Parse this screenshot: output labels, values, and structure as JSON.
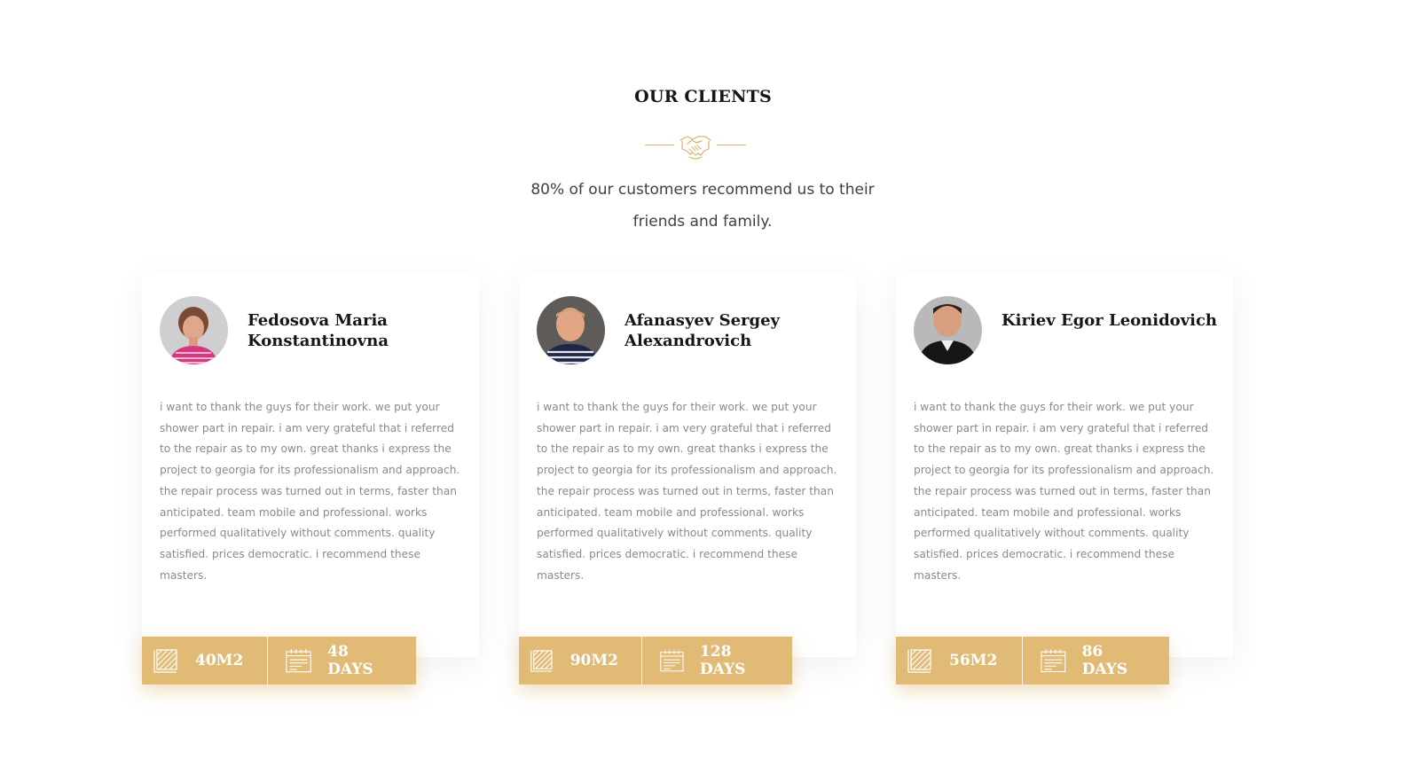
{
  "section": {
    "title": "OUR CLIENTS",
    "divider_icon": "handshake-icon",
    "subtitle": "80% of our customers recommend us to their friends and family."
  },
  "colors": {
    "accent": "#e1bb75",
    "heading": "#161616",
    "body_text": "#8a8a8a"
  },
  "clients": [
    {
      "name": "Fedosova Maria Konstantinovna",
      "review": "i want to thank the guys for their work. we put your shower part in repair. i am very grateful that i referred to the repair as to my own. great thanks i express the project to georgia for its professionalism and approach. the repair process was turned out in terms, faster than anticipated. team mobile and professional. works performed qualitatively without comments. quality satisfied. prices democratic. i recommend these masters.",
      "area": "40M2",
      "duration": "48 DAYS",
      "area_icon": "area-icon",
      "duration_icon": "calendar-icon"
    },
    {
      "name": "Afanasyev Sergey Alexandrovich",
      "review": "i want to thank the guys for their work. we put your shower part in repair. i am very grateful that i referred to the repair as to my own. great thanks i express the project to georgia for its professionalism and approach. the repair process was turned out in terms, faster than anticipated. team mobile and professional. works performed qualitatively without comments. quality satisfied. prices democratic. i recommend these masters.",
      "area": "90M2",
      "duration": "128 DAYS",
      "area_icon": "area-icon",
      "duration_icon": "calendar-icon"
    },
    {
      "name": "Kiriev Egor Leonidovich",
      "review": "i want to thank the guys for their work. we put your shower part in repair. i am very grateful that i referred to the repair as to my own. great thanks i express the project to georgia for its professionalism and approach. the repair process was turned out in terms, faster than anticipated. team mobile and professional. works performed qualitatively without comments. quality satisfied. prices democratic. i recommend these masters.",
      "area": "56M2",
      "duration": "86 DAYS",
      "area_icon": "area-icon",
      "duration_icon": "calendar-icon"
    }
  ]
}
